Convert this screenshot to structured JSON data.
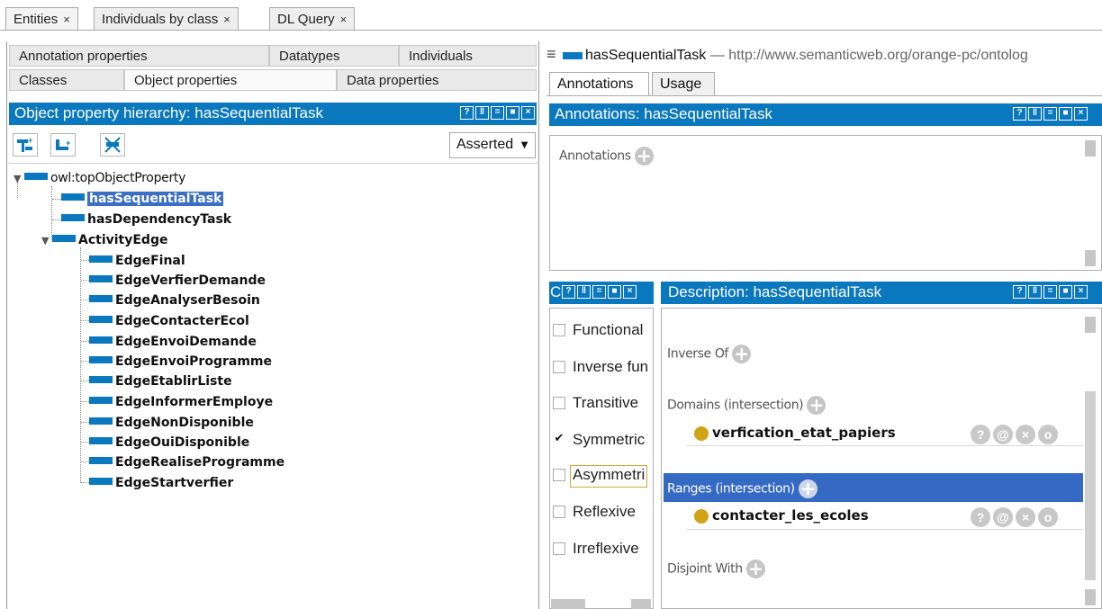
{
  "top_tabs": [
    {
      "label": "Entities",
      "close": "×"
    },
    {
      "label": "Individuals by class",
      "close": "×"
    },
    {
      "label": "DL Query",
      "close": "×"
    }
  ],
  "left_tabs": {
    "row1": [
      "Annotation properties",
      "Datatypes",
      "Individuals"
    ],
    "row2": [
      "Classes",
      "Object properties",
      "Data properties"
    ]
  },
  "hierarchy": {
    "title": "Object property hierarchy: hasSequentialTask",
    "mode": "Asserted",
    "root": "owl:topObjectProperty",
    "items": [
      "hasSequentialTask",
      "hasDependencyTask",
      "ActivityEdge"
    ],
    "children": [
      "EdgeFinal",
      "EdgeVerfierDemande",
      "EdgeAnalyserBesoin",
      "EdgeContacterEcol",
      "EdgeEnvoiDemande",
      "EdgeEnvoiProgramme",
      "EdgeEtablirListe",
      "EdgeInformerEmploye",
      "EdgeNonDisponible",
      "EdgeOuiDisponible",
      "EdgeRealiseProgramme",
      "EdgeStartverfier"
    ]
  },
  "right": {
    "entity": "hasSequentialTask",
    "dash": "—",
    "iri": "http://www.semanticweb.org/orange-pc/ontolog",
    "tabs": [
      "Annotations",
      "Usage"
    ],
    "annotations_title": "Annotations: hasSequentialTask",
    "annotations_label": "Annotations",
    "characteristics_title": "C",
    "characteristics": [
      {
        "label": "Functional",
        "checked": false
      },
      {
        "label": "Inverse fun",
        "checked": false
      },
      {
        "label": "Transitive",
        "checked": false
      },
      {
        "label": "Symmetric",
        "checked": true
      },
      {
        "label": "Asymmetri",
        "checked": false
      },
      {
        "label": "Reflexive",
        "checked": false
      },
      {
        "label": "Irreflexive",
        "checked": false
      }
    ],
    "description_title": "Description: hasSequentialTask",
    "inverse_of": "Inverse Of",
    "domains_label": "Domains (intersection)",
    "domain_value": "verfication_etat_papiers",
    "ranges_label": "Ranges (intersection)",
    "range_value": "contacter_les_ecoles",
    "disjoint_label": "Disjoint With",
    "check_mark": "✔",
    "plus": "+",
    "actions": [
      "?",
      "@",
      "×",
      "o"
    ]
  },
  "colors": {
    "accent": "#0a78be",
    "selection": "#3a6fc4",
    "individual_dot": "#d1a417"
  }
}
